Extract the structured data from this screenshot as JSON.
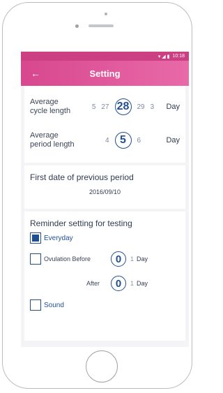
{
  "status_bar": {
    "time": "10:18",
    "signal_icons": "▾ ◢ ▮"
  },
  "app_bar": {
    "back_icon": "←",
    "title": "Setting"
  },
  "cycle": {
    "label_line1": "Average",
    "label_line2": "cycle length",
    "values": [
      "5",
      "27",
      "28",
      "29",
      "3"
    ],
    "selected": "28",
    "unit": "Day"
  },
  "period": {
    "label_line1": "Average",
    "label_line2": "period length",
    "values": [
      "4",
      "5",
      "6"
    ],
    "selected": "5",
    "unit": "Day"
  },
  "first_date": {
    "title": "First date of previous period",
    "value": "2016/09/10"
  },
  "reminder": {
    "title": "Reminder setting for testing",
    "everyday": {
      "label": "Everyday",
      "checked": true
    },
    "ovulation": {
      "label": "Ovulation Before",
      "value": "0",
      "next": "1",
      "unit": "Day",
      "checked": false
    },
    "after": {
      "label": "After",
      "value": "0",
      "next": "1",
      "unit": "Day"
    },
    "sound": {
      "label": "Sound",
      "checked": false
    }
  },
  "colors": {
    "accent_pink": "#d8478f",
    "accent_blue": "#1f4f91"
  }
}
